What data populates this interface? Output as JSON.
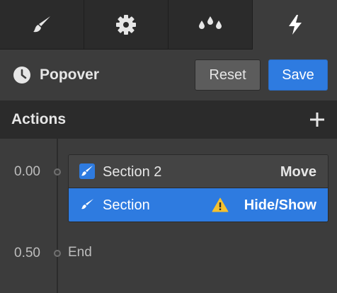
{
  "tabs": [
    {
      "icon": "paintbrush-icon",
      "active": false
    },
    {
      "icon": "gear-icon",
      "active": false
    },
    {
      "icon": "droplets-icon",
      "active": false
    },
    {
      "icon": "lightning-icon",
      "active": true
    }
  ],
  "header": {
    "icon": "clock-icon",
    "title": "Popover",
    "reset_label": "Reset",
    "save_label": "Save"
  },
  "actions": {
    "label": "Actions",
    "add_icon": "plus-icon"
  },
  "timeline": {
    "markers": [
      {
        "time": "0.00"
      },
      {
        "time": "0.50",
        "label": "End"
      }
    ],
    "steps": [
      {
        "name": "Section 2",
        "action": "Move",
        "icon": "brush-checkbox-icon",
        "selected": false,
        "warning": false
      },
      {
        "name": "Section",
        "action": "Hide/Show",
        "icon": "brush-icon",
        "selected": true,
        "warning": true
      }
    ]
  },
  "colors": {
    "accent": "#2e7be0",
    "background": "#3c3c3c",
    "bar": "#2b2b2b",
    "warning": "#f5c12e"
  }
}
